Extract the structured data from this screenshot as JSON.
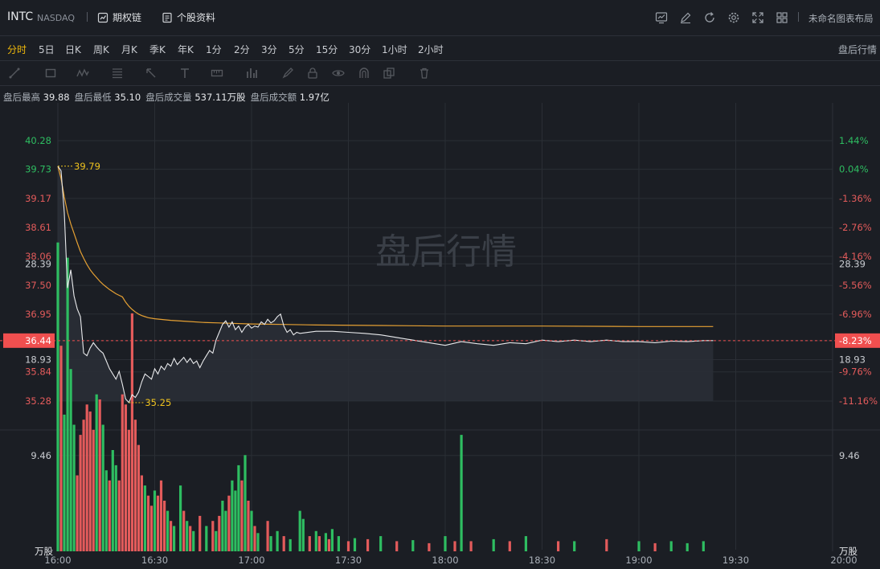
{
  "header": {
    "symbol": "INTC",
    "exchange": "NASDAQ",
    "options_chain": "期权链",
    "profile": "个股资料",
    "layout_name": "未命名图表布局"
  },
  "tabs": [
    "分时",
    "5日",
    "日K",
    "周K",
    "月K",
    "季K",
    "年K",
    "1分",
    "2分",
    "3分",
    "5分",
    "15分",
    "30分",
    "1小时",
    "2小时"
  ],
  "active_tab": "分时",
  "after_hours_label": "盘后行情",
  "stats": [
    {
      "label": "盘后最高",
      "value": "39.88"
    },
    {
      "label": "盘后最低",
      "value": "35.10"
    },
    {
      "label": "盘后成交量",
      "value": "537.11万股"
    },
    {
      "label": "盘后成交额",
      "value": "1.97亿"
    }
  ],
  "chart_data": {
    "type": "line",
    "watermark": "盘后行情",
    "price_axis": [
      "40.28",
      "39.73",
      "39.17",
      "38.61",
      "38.06",
      "37.50",
      "36.95",
      "36.44",
      "35.84",
      "35.28"
    ],
    "price_axis_values": [
      40.28,
      39.73,
      39.17,
      38.61,
      38.06,
      37.5,
      36.95,
      36.44,
      35.84,
      35.28
    ],
    "pct_axis": [
      "1.44%",
      "0.04%",
      "-1.36%",
      "-2.76%",
      "-4.16%",
      "-5.56%",
      "-6.96%",
      "-8.23%",
      "-9.76%",
      "-11.16%"
    ],
    "current_price": "36.44",
    "current_pct": "-8.23%",
    "high_label": "39.79",
    "low_label": "35.25",
    "ylim": [
      35.28,
      40.28
    ],
    "xlim": [
      "16:00",
      "20:00"
    ],
    "x_ticks": [
      "16:00",
      "16:30",
      "17:00",
      "17:30",
      "18:00",
      "18:30",
      "19:00",
      "19:30",
      "20:00"
    ],
    "volume_axis": [
      "28.39",
      "18.93",
      "9.46"
    ],
    "volume_axis_values": [
      28.39,
      18.93,
      9.46
    ],
    "volume_unit": "万股",
    "price_series": [
      [
        "16:00",
        39.79
      ],
      [
        "16:01",
        39.7
      ],
      [
        "16:02",
        38.9
      ],
      [
        "16:03",
        37.45
      ],
      [
        "16:04",
        37.8
      ],
      [
        "16:05",
        37.3
      ],
      [
        "16:06",
        37.05
      ],
      [
        "16:07",
        36.9
      ],
      [
        "16:08",
        36.2
      ],
      [
        "16:09",
        36.15
      ],
      [
        "16:10",
        36.3
      ],
      [
        "16:11",
        36.4
      ],
      [
        "16:12",
        36.32
      ],
      [
        "16:13",
        36.25
      ],
      [
        "16:14",
        36.2
      ],
      [
        "16:15",
        36.05
      ],
      [
        "16:16",
        35.9
      ],
      [
        "16:17",
        35.8
      ],
      [
        "16:18",
        35.7
      ],
      [
        "16:19",
        35.85
      ],
      [
        "16:20",
        35.6
      ],
      [
        "16:21",
        35.32
      ],
      [
        "16:22",
        35.25
      ],
      [
        "16:23",
        35.4
      ],
      [
        "16:24",
        35.35
      ],
      [
        "16:25",
        35.45
      ],
      [
        "16:26",
        35.65
      ],
      [
        "16:27",
        35.8
      ],
      [
        "16:28",
        35.75
      ],
      [
        "16:29",
        35.7
      ],
      [
        "16:30",
        35.9
      ],
      [
        "16:31",
        35.8
      ],
      [
        "16:32",
        35.95
      ],
      [
        "16:33",
        35.88
      ],
      [
        "16:34",
        36.0
      ],
      [
        "16:35",
        35.95
      ],
      [
        "16:36",
        36.1
      ],
      [
        "16:37",
        35.98
      ],
      [
        "16:38",
        36.05
      ],
      [
        "16:39",
        36.12
      ],
      [
        "16:40",
        36.02
      ],
      [
        "16:41",
        36.1
      ],
      [
        "16:42",
        36.0
      ],
      [
        "16:43",
        36.05
      ],
      [
        "16:44",
        35.92
      ],
      [
        "16:45",
        36.05
      ],
      [
        "16:46",
        36.15
      ],
      [
        "16:47",
        36.25
      ],
      [
        "16:48",
        36.2
      ],
      [
        "16:49",
        36.45
      ],
      [
        "16:50",
        36.6
      ],
      [
        "16:51",
        36.75
      ],
      [
        "16:52",
        36.82
      ],
      [
        "16:53",
        36.7
      ],
      [
        "16:54",
        36.8
      ],
      [
        "16:55",
        36.65
      ],
      [
        "16:56",
        36.72
      ],
      [
        "16:57",
        36.6
      ],
      [
        "16:58",
        36.7
      ],
      [
        "16:59",
        36.75
      ],
      [
        "17:00",
        36.68
      ],
      [
        "17:01",
        36.72
      ],
      [
        "17:02",
        36.7
      ],
      [
        "17:03",
        36.8
      ],
      [
        "17:04",
        36.75
      ],
      [
        "17:05",
        36.85
      ],
      [
        "17:06",
        36.78
      ],
      [
        "17:07",
        36.82
      ],
      [
        "17:08",
        36.9
      ],
      [
        "17:09",
        36.95
      ],
      [
        "17:10",
        36.72
      ],
      [
        "17:11",
        36.6
      ],
      [
        "17:12",
        36.65
      ],
      [
        "17:13",
        36.55
      ],
      [
        "17:14",
        36.6
      ],
      [
        "17:15",
        36.58
      ],
      [
        "17:20",
        36.62
      ],
      [
        "17:25",
        36.62
      ],
      [
        "17:30",
        36.6
      ],
      [
        "17:35",
        36.58
      ],
      [
        "17:40",
        36.55
      ],
      [
        "17:45",
        36.5
      ],
      [
        "17:50",
        36.45
      ],
      [
        "17:55",
        36.4
      ],
      [
        "18:00",
        36.35
      ],
      [
        "18:05",
        36.42
      ],
      [
        "18:10",
        36.38
      ],
      [
        "18:15",
        36.35
      ],
      [
        "18:20",
        36.4
      ],
      [
        "18:25",
        36.38
      ],
      [
        "18:30",
        36.45
      ],
      [
        "18:35",
        36.42
      ],
      [
        "18:40",
        36.45
      ],
      [
        "18:45",
        36.42
      ],
      [
        "18:50",
        36.45
      ],
      [
        "18:55",
        36.42
      ],
      [
        "19:00",
        36.42
      ],
      [
        "19:05",
        36.4
      ],
      [
        "19:10",
        36.43
      ],
      [
        "19:15",
        36.42
      ],
      [
        "19:20",
        36.44
      ],
      [
        "19:23",
        36.44
      ]
    ],
    "avg_series": [
      [
        "16:00",
        39.79
      ],
      [
        "16:01",
        39.55
      ],
      [
        "16:02",
        39.2
      ],
      [
        "16:03",
        38.9
      ],
      [
        "16:04",
        38.68
      ],
      [
        "16:05",
        38.5
      ],
      [
        "16:06",
        38.32
      ],
      [
        "16:07",
        38.15
      ],
      [
        "16:08",
        38.02
      ],
      [
        "16:09",
        37.9
      ],
      [
        "16:10",
        37.8
      ],
      [
        "16:11",
        37.72
      ],
      [
        "16:12",
        37.65
      ],
      [
        "16:13",
        37.58
      ],
      [
        "16:14",
        37.52
      ],
      [
        "16:15",
        37.47
      ],
      [
        "16:16",
        37.42
      ],
      [
        "16:17",
        37.38
      ],
      [
        "16:18",
        37.34
      ],
      [
        "16:19",
        37.31
      ],
      [
        "16:20",
        37.28
      ],
      [
        "16:21",
        37.18
      ],
      [
        "16:22",
        37.1
      ],
      [
        "16:23",
        37.04
      ],
      [
        "16:24",
        36.99
      ],
      [
        "16:25",
        36.95
      ],
      [
        "16:26",
        36.92
      ],
      [
        "16:27",
        36.9
      ],
      [
        "16:28",
        36.88
      ],
      [
        "16:30",
        36.86
      ],
      [
        "16:35",
        36.83
      ],
      [
        "16:40",
        36.81
      ],
      [
        "16:45",
        36.79
      ],
      [
        "16:50",
        36.78
      ],
      [
        "17:00",
        36.76
      ],
      [
        "17:10",
        36.75
      ],
      [
        "17:20",
        36.74
      ],
      [
        "17:40",
        36.73
      ],
      [
        "18:00",
        36.72
      ],
      [
        "18:30",
        36.72
      ],
      [
        "19:00",
        36.71
      ],
      [
        "19:23",
        36.71
      ]
    ],
    "volume_series": [
      [
        "16:00",
        30.5,
        "up"
      ],
      [
        "16:01",
        20.3,
        "down"
      ],
      [
        "16:02",
        13.5,
        "up"
      ],
      [
        "16:03",
        29.0,
        "up"
      ],
      [
        "16:04",
        18.0,
        "up"
      ],
      [
        "16:05",
        12.5,
        "up"
      ],
      [
        "16:06",
        7.5,
        "down"
      ],
      [
        "16:07",
        11.5,
        "down"
      ],
      [
        "16:08",
        13.0,
        "down"
      ],
      [
        "16:09",
        14.5,
        "down"
      ],
      [
        "16:10",
        13.8,
        "down"
      ],
      [
        "16:11",
        12.0,
        "down"
      ],
      [
        "16:12",
        15.5,
        "up"
      ],
      [
        "16:13",
        15.0,
        "down"
      ],
      [
        "16:14",
        12.5,
        "up"
      ],
      [
        "16:15",
        8.0,
        "up"
      ],
      [
        "16:16",
        7.0,
        "down"
      ],
      [
        "16:17",
        10.0,
        "up"
      ],
      [
        "16:18",
        8.5,
        "up"
      ],
      [
        "16:19",
        7.0,
        "down"
      ],
      [
        "16:20",
        15.5,
        "down"
      ],
      [
        "16:21",
        14.5,
        "down"
      ],
      [
        "16:22",
        12.0,
        "down"
      ],
      [
        "16:23",
        23.5,
        "down"
      ],
      [
        "16:24",
        13.0,
        "down"
      ],
      [
        "16:25",
        10.5,
        "down"
      ],
      [
        "16:26",
        7.5,
        "down"
      ],
      [
        "16:27",
        6.5,
        "up"
      ],
      [
        "16:28",
        5.5,
        "down"
      ],
      [
        "16:29",
        4.5,
        "down"
      ],
      [
        "16:30",
        6.0,
        "up"
      ],
      [
        "16:31",
        5.5,
        "down"
      ],
      [
        "16:32",
        7.0,
        "down"
      ],
      [
        "16:33",
        5.0,
        "down"
      ],
      [
        "16:34",
        4.0,
        "up"
      ],
      [
        "16:35",
        3.0,
        "down"
      ],
      [
        "16:36",
        2.5,
        "up"
      ],
      [
        "16:38",
        6.5,
        "up"
      ],
      [
        "16:39",
        4.0,
        "down"
      ],
      [
        "16:40",
        3.0,
        "up"
      ],
      [
        "16:41",
        2.5,
        "down"
      ],
      [
        "16:42",
        2.0,
        "up"
      ],
      [
        "16:44",
        3.5,
        "down"
      ],
      [
        "16:46",
        2.5,
        "up"
      ],
      [
        "16:48",
        3.0,
        "down"
      ],
      [
        "16:49",
        2.0,
        "up"
      ],
      [
        "16:50",
        3.5,
        "down"
      ],
      [
        "16:51",
        5.0,
        "up"
      ],
      [
        "16:52",
        4.0,
        "up"
      ],
      [
        "16:53",
        5.5,
        "down"
      ],
      [
        "16:54",
        7.0,
        "up"
      ],
      [
        "16:55",
        6.0,
        "up"
      ],
      [
        "16:56",
        8.5,
        "up"
      ],
      [
        "16:57",
        7.0,
        "down"
      ],
      [
        "16:58",
        9.5,
        "up"
      ],
      [
        "16:59",
        5.0,
        "down"
      ],
      [
        "17:00",
        4.0,
        "up"
      ],
      [
        "17:01",
        2.5,
        "down"
      ],
      [
        "17:02",
        1.8,
        "up"
      ],
      [
        "17:05",
        3.0,
        "down"
      ],
      [
        "17:06",
        1.5,
        "up"
      ],
      [
        "17:08",
        2.0,
        "up"
      ],
      [
        "17:10",
        1.5,
        "down"
      ],
      [
        "17:12",
        1.2,
        "up"
      ],
      [
        "17:15",
        4.0,
        "up"
      ],
      [
        "17:16",
        3.2,
        "up"
      ],
      [
        "17:18",
        1.5,
        "down"
      ],
      [
        "17:20",
        2.0,
        "up"
      ],
      [
        "17:21",
        1.5,
        "down"
      ],
      [
        "17:23",
        1.8,
        "up"
      ],
      [
        "17:24",
        1.2,
        "down"
      ],
      [
        "17:25",
        2.2,
        "up"
      ],
      [
        "17:27",
        1.5,
        "up"
      ],
      [
        "17:30",
        1.0,
        "down"
      ],
      [
        "17:32",
        1.3,
        "up"
      ],
      [
        "17:36",
        1.2,
        "down"
      ],
      [
        "17:40",
        1.5,
        "up"
      ],
      [
        "17:45",
        1.0,
        "down"
      ],
      [
        "17:50",
        1.1,
        "up"
      ],
      [
        "17:55",
        0.8,
        "down"
      ],
      [
        "18:00",
        1.5,
        "up"
      ],
      [
        "18:03",
        1.0,
        "down"
      ],
      [
        "18:05",
        11.5,
        "up"
      ],
      [
        "18:08",
        1.0,
        "down"
      ],
      [
        "18:15",
        1.2,
        "up"
      ],
      [
        "18:20",
        1.0,
        "down"
      ],
      [
        "18:25",
        1.5,
        "up"
      ],
      [
        "18:35",
        1.0,
        "down"
      ],
      [
        "18:40",
        1.0,
        "up"
      ],
      [
        "18:50",
        1.2,
        "down"
      ],
      [
        "19:00",
        1.0,
        "up"
      ],
      [
        "19:05",
        0.8,
        "down"
      ],
      [
        "19:10",
        1.0,
        "up"
      ],
      [
        "19:15",
        0.8,
        "up"
      ],
      [
        "19:20",
        1.0,
        "up"
      ]
    ],
    "colors": {
      "up": "#2ebd61",
      "down": "#e35b5b",
      "price_line": "#e9eaec",
      "avg_line": "#e5a033",
      "current": "#f04f4f",
      "annotation": "#f0c31e"
    }
  }
}
